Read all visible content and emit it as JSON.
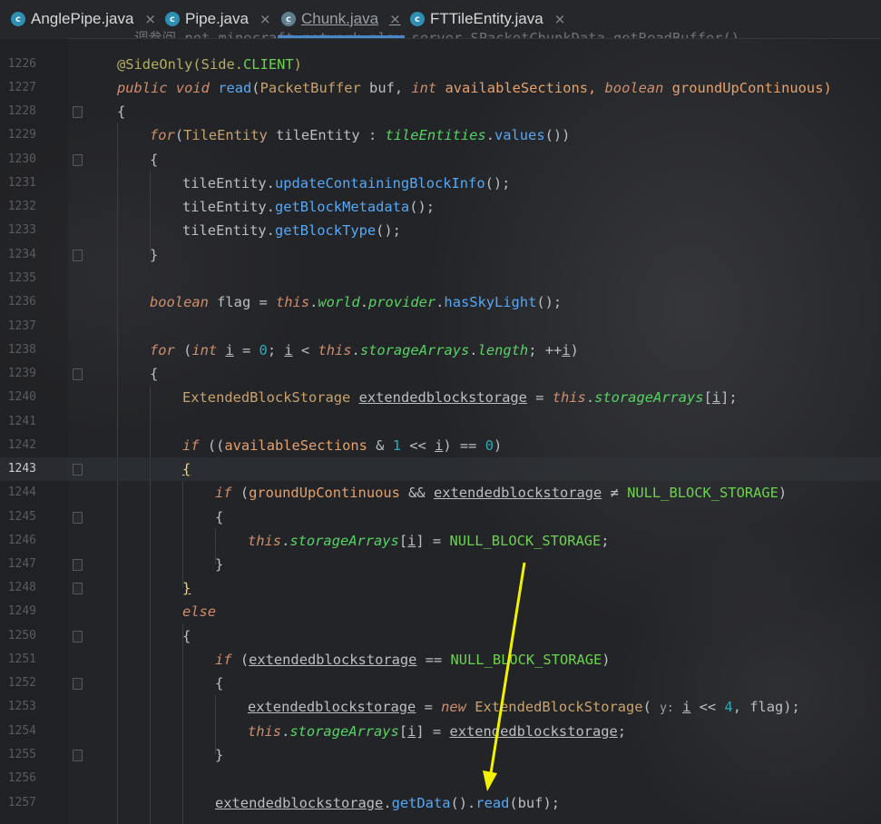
{
  "tabs": [
    {
      "label": "AnglePipe.java",
      "close": "×"
    },
    {
      "label": "Pipe.java",
      "close": "×"
    },
    {
      "label": "Chunk.java",
      "close": "×"
    },
    {
      "label": "FTTileEntity.java",
      "close": "×"
    }
  ],
  "editor": {
    "partial_top_line": "调参阅 net.minecraft.network.play.server.SPacketChunkData.getReadBuffer()",
    "line_numbers": [
      "1226",
      "1227",
      "1228",
      "1229",
      "1230",
      "1231",
      "1232",
      "1233",
      "1234",
      "1235",
      "1236",
      "1237",
      "1238",
      "1239",
      "1240",
      "1241",
      "1242",
      "1243",
      "1244",
      "1245",
      "1246",
      "1247",
      "1248",
      "1249",
      "1250",
      "1251",
      "1252",
      "1253",
      "1254",
      "1255",
      "1256",
      "1257"
    ],
    "current_line": "1243",
    "code": {
      "l1226_ann": "@SideOnly(",
      "l1226_type": "Side",
      "l1226_dot": ".",
      "l1226_const": "CLIENT",
      "l1226_end": ")",
      "l1227_pub": "public",
      "l1227_void": " void ",
      "l1227_name": "read",
      "l1227_a": "(",
      "l1227_t1": "PacketBuffer",
      "l1227_p1": " buf, ",
      "l1227_int": "int",
      "l1227_p2": " availableSections, ",
      "l1227_bool": "boolean",
      "l1227_p3": " groundUpContinuous)",
      "brace_open": "{",
      "brace_close": "}",
      "l1229_for": "for",
      "l1229_a": "(",
      "l1229_type": "TileEntity",
      "l1229_b": " tileEntity : ",
      "l1229_field": "tileEntities",
      "l1229_c": ".",
      "l1229_m": "values",
      "l1229_d": "())",
      "l1231_obj": "tileEntity.",
      "l1231_m": "updateContainingBlockInfo",
      "l1231_end": "();",
      "l1232_obj": "tileEntity.",
      "l1232_m": "getBlockMetadata",
      "l1232_end": "();",
      "l1233_obj": "tileEntity.",
      "l1233_m": "getBlockType",
      "l1233_end": "();",
      "l1236_bool": "boolean",
      "l1236_a": " flag = ",
      "l1236_this": "this",
      "l1236_dot": ".",
      "l1236_world": "world",
      "l1236_dot2": ".",
      "l1236_prov": "provider",
      "l1236_dot3": ".",
      "l1236_m": "hasSkyLight",
      "l1236_end": "();",
      "l1238_for": "for",
      "l1238_a": " (",
      "l1238_int": "int",
      "l1238_sp": " ",
      "l1238_i": "i",
      "l1238_b": " = ",
      "l1238_zero": "0",
      "l1238_c": "; ",
      "l1238_i2": "i",
      "l1238_d": " < ",
      "l1238_this": "this",
      "l1238_e": ".",
      "l1238_arr": "storageArrays",
      "l1238_f": ".",
      "l1238_len": "length",
      "l1238_g": "; ++",
      "l1238_i3": "i",
      "l1238_h": ")",
      "l1240_type": "ExtendedBlockStorage",
      "l1240_sp": " ",
      "l1240_var": "extendedblockstorage",
      "l1240_a": " = ",
      "l1240_this": "this",
      "l1240_b": ".",
      "l1240_arr": "storageArrays",
      "l1240_c": "[",
      "l1240_i": "i",
      "l1240_d": "];",
      "l1242_if": "if",
      "l1242_a": " ((",
      "l1242_p": "availableSections",
      "l1242_b": " & ",
      "l1242_one": "1",
      "l1242_c": " << ",
      "l1242_i": "i",
      "l1242_d": ") == ",
      "l1242_zero": "0",
      "l1242_e": ")",
      "l1244_if": "if",
      "l1244_a": " (",
      "l1244_p": "groundUpContinuous",
      "l1244_b": " && ",
      "l1244_var": "extendedblockstorage",
      "l1244_c": " ≠ ",
      "l1244_const": "NULL_BLOCK_STORAGE",
      "l1244_d": ")",
      "l1246_this": "this",
      "l1246_a": ".",
      "l1246_arr": "storageArrays",
      "l1246_b": "[",
      "l1246_i": "i",
      "l1246_c": "] = ",
      "l1246_const": "NULL_BLOCK_STORAGE",
      "l1246_d": ";",
      "l1249_else": "else",
      "l1251_if": "if",
      "l1251_a": " (",
      "l1251_var": "extendedblockstorage",
      "l1251_b": " == ",
      "l1251_const": "NULL_BLOCK_STORAGE",
      "l1251_c": ")",
      "l1253_var": "extendedblockstorage",
      "l1253_a": " = ",
      "l1253_new": "new",
      "l1253_sp": " ",
      "l1253_type": "ExtendedBlockStorage",
      "l1253_b": "( ",
      "l1253_hint": "y:",
      "l1253_sp2": " ",
      "l1253_i": "i",
      "l1253_c": " << ",
      "l1253_four": "4",
      "l1253_d": ", flag);",
      "l1254_this": "this",
      "l1254_a": ".",
      "l1254_arr": "storageArrays",
      "l1254_b": "[",
      "l1254_i": "i",
      "l1254_c": "] = ",
      "l1254_var": "extendedblockstorage",
      "l1254_d": ";",
      "l1257_var": "extendedblockstorage",
      "l1257_a": ".",
      "l1257_m1": "getData",
      "l1257_b": "().",
      "l1257_m2": "read",
      "l1257_c": "(buf);"
    }
  },
  "colors": {
    "arrow": "#f2f200",
    "background": "#232427",
    "accent": "#4a88c7"
  }
}
